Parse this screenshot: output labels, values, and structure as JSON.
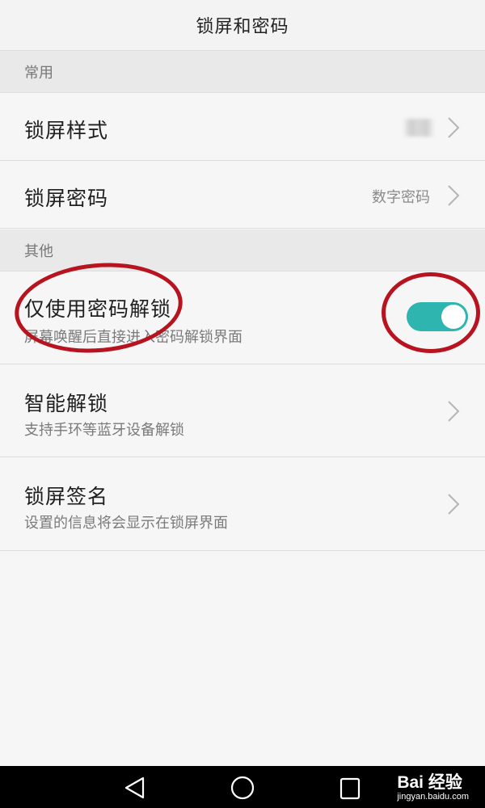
{
  "header": {
    "title": "锁屏和密码"
  },
  "sections": {
    "common": {
      "label": "常用"
    },
    "other": {
      "label": "其他"
    }
  },
  "rows": {
    "lock_style": {
      "label": "锁屏样式"
    },
    "lock_password": {
      "label": "锁屏密码",
      "value": "数字密码"
    },
    "password_only": {
      "label": "仅使用密码解锁",
      "sublabel": "屏幕唤醒后直接进入密码解锁界面",
      "toggle_on": true
    },
    "smart_unlock": {
      "label": "智能解锁",
      "sublabel": "支持手环等蓝牙设备解锁"
    },
    "lock_signature": {
      "label": "锁屏签名",
      "sublabel": "设置的信息将会显示在锁屏界面"
    }
  },
  "colors": {
    "toggle_on": "#2fb5b0",
    "annotation": "#b81420"
  },
  "watermark": {
    "logo": "Bai 经验",
    "url": "jingyan.baidu.com"
  },
  "icons": {
    "back": "triangle-back-icon",
    "home": "circle-home-icon",
    "recents": "square-recents-icon",
    "chevron": "chevron-right-icon"
  }
}
